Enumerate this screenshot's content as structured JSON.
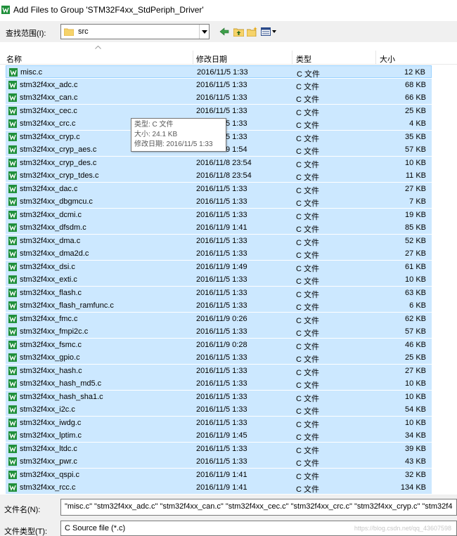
{
  "window": {
    "title": "Add Files to Group 'STM32F4xx_StdPeriph_Driver'"
  },
  "toolbar": {
    "lookin_label": "查找范围(I):",
    "lookin_value": "src"
  },
  "columns": {
    "name": "名称",
    "date": "修改日期",
    "type": "类型",
    "size": "大小"
  },
  "files": [
    {
      "name": "misc.c",
      "date": "2016/11/5 1:33",
      "type": "C 文件",
      "size": "12 KB"
    },
    {
      "name": "stm32f4xx_adc.c",
      "date": "2016/11/5 1:33",
      "type": "C 文件",
      "size": "68 KB"
    },
    {
      "name": "stm32f4xx_can.c",
      "date": "2016/11/5 1:33",
      "type": "C 文件",
      "size": "66 KB"
    },
    {
      "name": "stm32f4xx_cec.c",
      "date": "2016/11/5 1:33",
      "type": "C 文件",
      "size": "25 KB"
    },
    {
      "name": "stm32f4xx_crc.c",
      "date": "2016/11/5 1:33",
      "type": "C 文件",
      "size": "4 KB"
    },
    {
      "name": "stm32f4xx_cryp.c",
      "date": "2016/11/5 1:33",
      "type": "C 文件",
      "size": "35 KB"
    },
    {
      "name": "stm32f4xx_cryp_aes.c",
      "date": "2016/11/9 1:54",
      "type": "C 文件",
      "size": "57 KB"
    },
    {
      "name": "stm32f4xx_cryp_des.c",
      "date": "2016/11/8 23:54",
      "type": "C 文件",
      "size": "10 KB"
    },
    {
      "name": "stm32f4xx_cryp_tdes.c",
      "date": "2016/11/8 23:54",
      "type": "C 文件",
      "size": "11 KB"
    },
    {
      "name": "stm32f4xx_dac.c",
      "date": "2016/11/5 1:33",
      "type": "C 文件",
      "size": "27 KB"
    },
    {
      "name": "stm32f4xx_dbgmcu.c",
      "date": "2016/11/5 1:33",
      "type": "C 文件",
      "size": "7 KB"
    },
    {
      "name": "stm32f4xx_dcmi.c",
      "date": "2016/11/5 1:33",
      "type": "C 文件",
      "size": "19 KB"
    },
    {
      "name": "stm32f4xx_dfsdm.c",
      "date": "2016/11/9 1:41",
      "type": "C 文件",
      "size": "85 KB"
    },
    {
      "name": "stm32f4xx_dma.c",
      "date": "2016/11/5 1:33",
      "type": "C 文件",
      "size": "52 KB"
    },
    {
      "name": "stm32f4xx_dma2d.c",
      "date": "2016/11/5 1:33",
      "type": "C 文件",
      "size": "27 KB"
    },
    {
      "name": "stm32f4xx_dsi.c",
      "date": "2016/11/9 1:49",
      "type": "C 文件",
      "size": "61 KB"
    },
    {
      "name": "stm32f4xx_exti.c",
      "date": "2016/11/5 1:33",
      "type": "C 文件",
      "size": "10 KB"
    },
    {
      "name": "stm32f4xx_flash.c",
      "date": "2016/11/5 1:33",
      "type": "C 文件",
      "size": "63 KB"
    },
    {
      "name": "stm32f4xx_flash_ramfunc.c",
      "date": "2016/11/5 1:33",
      "type": "C 文件",
      "size": "6 KB"
    },
    {
      "name": "stm32f4xx_fmc.c",
      "date": "2016/11/9 0:26",
      "type": "C 文件",
      "size": "62 KB"
    },
    {
      "name": "stm32f4xx_fmpi2c.c",
      "date": "2016/11/5 1:33",
      "type": "C 文件",
      "size": "57 KB"
    },
    {
      "name": "stm32f4xx_fsmc.c",
      "date": "2016/11/9 0:28",
      "type": "C 文件",
      "size": "46 KB"
    },
    {
      "name": "stm32f4xx_gpio.c",
      "date": "2016/11/5 1:33",
      "type": "C 文件",
      "size": "25 KB"
    },
    {
      "name": "stm32f4xx_hash.c",
      "date": "2016/11/5 1:33",
      "type": "C 文件",
      "size": "27 KB"
    },
    {
      "name": "stm32f4xx_hash_md5.c",
      "date": "2016/11/5 1:33",
      "type": "C 文件",
      "size": "10 KB"
    },
    {
      "name": "stm32f4xx_hash_sha1.c",
      "date": "2016/11/5 1:33",
      "type": "C 文件",
      "size": "10 KB"
    },
    {
      "name": "stm32f4xx_i2c.c",
      "date": "2016/11/5 1:33",
      "type": "C 文件",
      "size": "54 KB"
    },
    {
      "name": "stm32f4xx_iwdg.c",
      "date": "2016/11/5 1:33",
      "type": "C 文件",
      "size": "10 KB"
    },
    {
      "name": "stm32f4xx_lptim.c",
      "date": "2016/11/9 1:45",
      "type": "C 文件",
      "size": "34 KB"
    },
    {
      "name": "stm32f4xx_ltdc.c",
      "date": "2016/11/5 1:33",
      "type": "C 文件",
      "size": "39 KB"
    },
    {
      "name": "stm32f4xx_pwr.c",
      "date": "2016/11/5 1:33",
      "type": "C 文件",
      "size": "43 KB"
    },
    {
      "name": "stm32f4xx_qspi.c",
      "date": "2016/11/9 1:41",
      "type": "C 文件",
      "size": "32 KB"
    },
    {
      "name": "stm32f4xx_rcc.c",
      "date": "2016/11/9 1:41",
      "type": "C 文件",
      "size": "134 KB"
    }
  ],
  "tooltip": {
    "type_line": "类型: C 文件",
    "size_line": "大小: 24.1 KB",
    "date_line": "修改日期: 2016/11/5 1:33"
  },
  "filename": {
    "label": "文件名(N):",
    "value": "\"misc.c\" \"stm32f4xx_adc.c\" \"stm32f4xx_can.c\" \"stm32f4xx_cec.c\" \"stm32f4xx_crc.c\" \"stm32f4xx_cryp.c\" \"stm32f4"
  },
  "filetype": {
    "label": "文件类型(T):",
    "value": "C Source file (*.c)"
  },
  "watermark": "https://blog.csdn.net/qq_43607598",
  "colors": {
    "selection": "#cce8ff",
    "selection_border": "#99d1ff",
    "dialog_bg": "#f0f0f0",
    "icon_green": "#1f8f3a"
  }
}
